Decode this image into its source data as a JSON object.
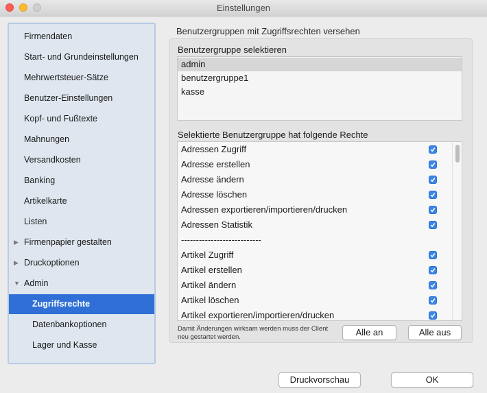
{
  "window": {
    "title": "Einstellungen"
  },
  "sidebar": {
    "items": [
      {
        "label": "Firmendaten"
      },
      {
        "label": "Start- und Grundeinstellungen"
      },
      {
        "label": "Mehrwertsteuer-Sätze"
      },
      {
        "label": "Benutzer-Einstellungen"
      },
      {
        "label": "Kopf- und Fußtexte"
      },
      {
        "label": "Mahnungen"
      },
      {
        "label": "Versandkosten"
      },
      {
        "label": "Banking"
      },
      {
        "label": "Artikelkarte"
      },
      {
        "label": "Listen"
      },
      {
        "label": "Firmenpapier gestalten",
        "disclosure": "collapsed"
      },
      {
        "label": "Druckoptionen",
        "disclosure": "collapsed"
      },
      {
        "label": "Admin",
        "disclosure": "expanded"
      },
      {
        "label": "Zugriffsrechte",
        "selected": true
      },
      {
        "label": "Datenbankoptionen"
      },
      {
        "label": "Lager und Kasse"
      }
    ]
  },
  "main": {
    "section_title": "Benutzergruppen mit Zugriffsrechten versehen",
    "groups_label": "Benutzergruppe selektieren",
    "groups": [
      {
        "name": "admin",
        "selected": true
      },
      {
        "name": "benutzergruppe1"
      },
      {
        "name": "kasse"
      }
    ],
    "rights_label": "Selektierte Benutzergruppe hat folgende Rechte",
    "rights": [
      {
        "label": "Adressen Zugriff",
        "checked": true
      },
      {
        "label": "Adresse erstellen",
        "checked": true
      },
      {
        "label": "Adresse ändern",
        "checked": true
      },
      {
        "label": "Adresse löschen",
        "checked": true
      },
      {
        "label": "Adressen exportieren/importieren/drucken",
        "checked": true
      },
      {
        "label": "Adressen Statistik",
        "checked": true
      },
      {
        "label": "---------------------------",
        "checked": false
      },
      {
        "label": "Artikel Zugriff",
        "checked": true
      },
      {
        "label": "Artikel erstellen",
        "checked": true
      },
      {
        "label": "Artikel ändern",
        "checked": true
      },
      {
        "label": "Artikel löschen",
        "checked": true
      },
      {
        "label": "Artikel exportieren/importieren/drucken",
        "checked": true
      }
    ],
    "note": "Damit Änderungen wirksam werden muss der Client neu gestartet werden.",
    "all_on_label": "Alle an",
    "all_off_label": "Alle aus"
  },
  "footer": {
    "preview_label": "Druckvorschau",
    "ok_label": "OK"
  },
  "colors": {
    "accent": "#2f6fd6",
    "checkbox": "#3b86e6"
  }
}
